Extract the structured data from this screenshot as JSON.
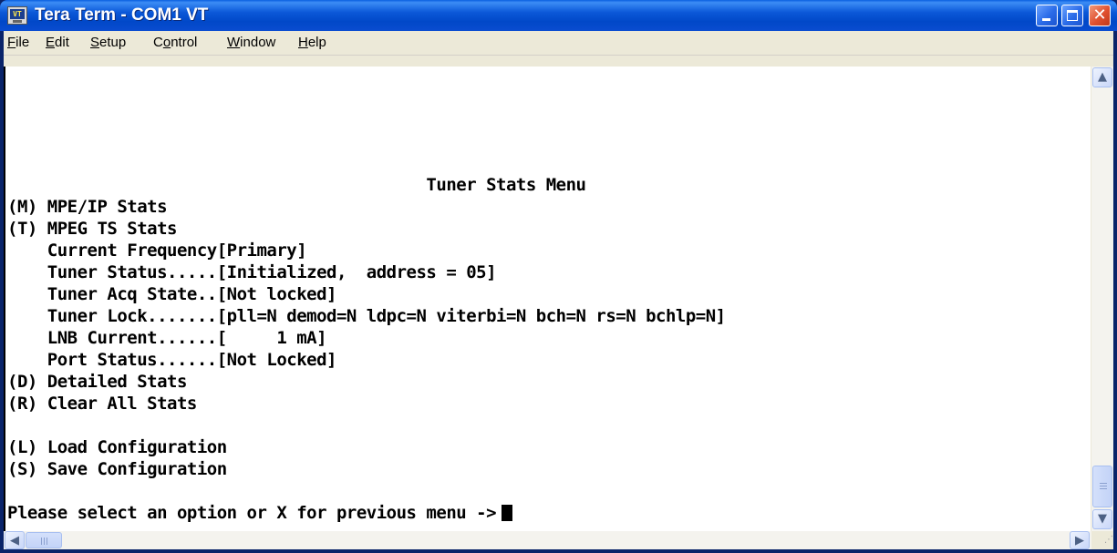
{
  "window": {
    "title": "Tera Term - COM1 VT",
    "icon": "terminal-app-icon",
    "icon_text": "VT",
    "controls": {
      "minimize": "minimize-icon",
      "maximize": "maximize-icon",
      "close": "close-icon",
      "close_glyph": "✕"
    }
  },
  "menu": {
    "items": [
      {
        "pre": "",
        "u": "F",
        "post": "ile"
      },
      {
        "pre": "",
        "u": "E",
        "post": "dit"
      },
      {
        "pre": "",
        "u": "S",
        "post": "etup"
      },
      {
        "pre": "C",
        "u": "o",
        "post": "ntrol"
      },
      {
        "pre": "",
        "u": "W",
        "post": "indow"
      },
      {
        "pre": "",
        "u": "H",
        "post": "elp"
      }
    ]
  },
  "terminal": {
    "lines": [
      "                                          Tuner Stats Menu",
      "(M) MPE/IP Stats",
      "(T) MPEG TS Stats",
      "    Current Frequency[Primary]",
      "    Tuner Status.....[Initialized,  address = 05]",
      "    Tuner Acq State..[Not locked]",
      "    Tuner Lock.......[pll=N demod=N ldpc=N viterbi=N bch=N rs=N bchlp=N]",
      "    LNB Current......[     1 mA]",
      "    Port Status......[Not Locked]",
      "(D) Detailed Stats",
      "(R) Clear All Stats",
      "",
      "(L) Load Configuration",
      "(S) Save Configuration",
      "",
      "Please select an option or X for previous menu ->"
    ]
  },
  "scrollbars": {
    "up_glyph": "▲",
    "down_glyph": "▼",
    "left_glyph": "◀",
    "right_glyph": "▶",
    "resize_glyph": "⋰"
  }
}
